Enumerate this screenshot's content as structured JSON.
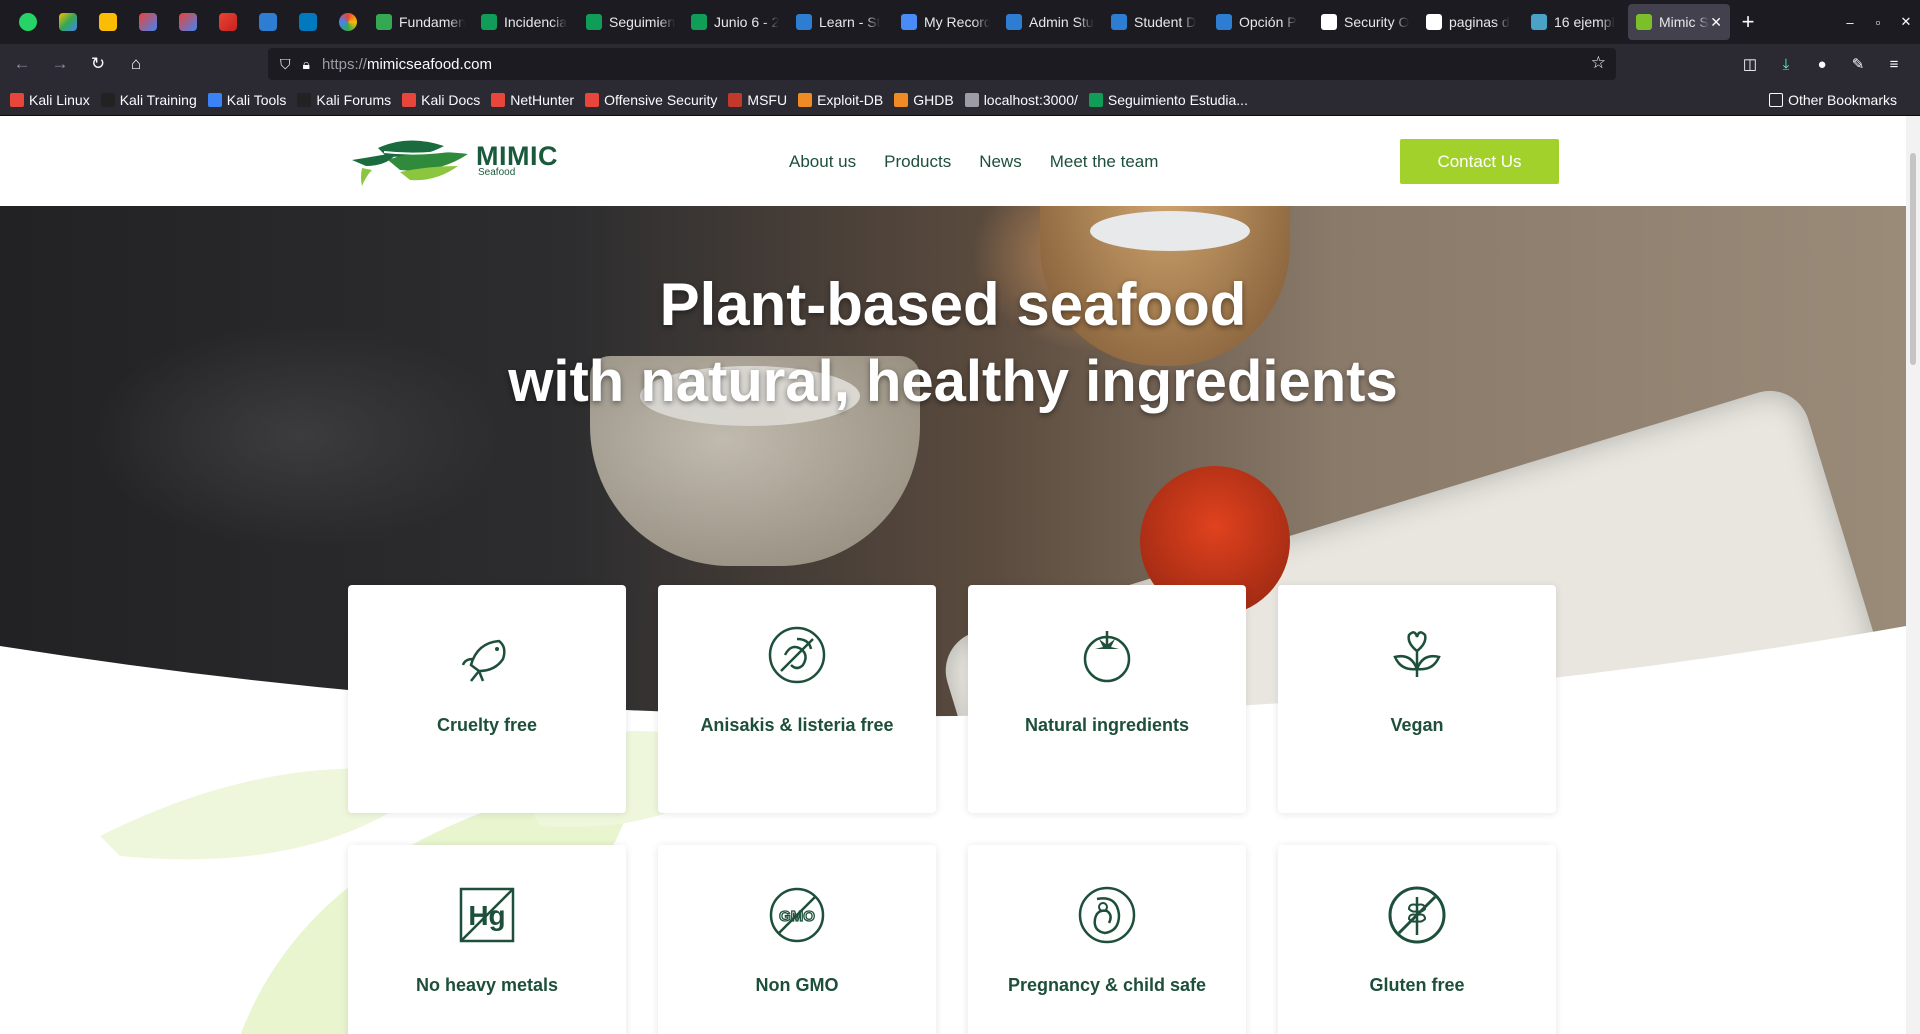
{
  "browser": {
    "tabs": [
      {
        "label": "Fundamen",
        "color": "#34a853"
      },
      {
        "label": "Incidencia",
        "color": "#0f9d58"
      },
      {
        "label": "Seguimien",
        "color": "#0f9d58"
      },
      {
        "label": "Junio 6 - 2",
        "color": "#0f9d58"
      },
      {
        "label": "Learn - St",
        "color": "#2d7dd2"
      },
      {
        "label": "My Record",
        "color": "#4a8cf7"
      },
      {
        "label": "Admin Stu",
        "color": "#2d7dd2"
      },
      {
        "label": "Student D",
        "color": "#2d7dd2"
      },
      {
        "label": "Opción P",
        "color": "#2d7dd2"
      },
      {
        "label": "Security O",
        "color": "#ffffff"
      },
      {
        "label": "paginas d",
        "color": "#ffffff"
      },
      {
        "label": "16 ejempl",
        "color": "#4aa3c7"
      }
    ],
    "active_tab": {
      "label": "Mimic S"
    },
    "url_proto": "https://",
    "url_host": "mimicseafood.com",
    "bookmarks": [
      {
        "label": "Kali Linux",
        "color": "#e8453c"
      },
      {
        "label": "Kali Training",
        "color": "#222222"
      },
      {
        "label": "Kali Tools",
        "color": "#3b82f6"
      },
      {
        "label": "Kali Forums",
        "color": "#222222"
      },
      {
        "label": "Kali Docs",
        "color": "#e8453c"
      },
      {
        "label": "NetHunter",
        "color": "#e8453c"
      },
      {
        "label": "Offensive Security",
        "color": "#e8453c"
      },
      {
        "label": "MSFU",
        "color": "#c0392b"
      },
      {
        "label": "Exploit-DB",
        "color": "#f08a24"
      },
      {
        "label": "GHDB",
        "color": "#f08a24"
      },
      {
        "label": "localhost:3000/",
        "color": "#9c9ca6"
      },
      {
        "label": "Seguimiento Estudia...",
        "color": "#0f9d58"
      }
    ],
    "other_bookmarks": "Other Bookmarks"
  },
  "site": {
    "logo": {
      "name": "MIMIC",
      "sub": "Seafood"
    },
    "nav": [
      "About us",
      "Products",
      "News",
      "Meet the team"
    ],
    "cta": "Contact Us",
    "hero_line1": "Plant-based seafood",
    "hero_line2": "with natural, healthy ingredients",
    "features": [
      {
        "label": "Cruelty free",
        "icon": "fish-icon"
      },
      {
        "label": "Anisakis & listeria free",
        "icon": "no-parasite-icon"
      },
      {
        "label": "Natural ingredients",
        "icon": "tomato-icon"
      },
      {
        "label": "Vegan",
        "icon": "vegan-heart-leaf-icon"
      },
      {
        "label": "No heavy metals",
        "icon": "no-mercury-icon"
      },
      {
        "label": "Non GMO",
        "icon": "non-gmo-icon"
      },
      {
        "label": "Pregnancy & child safe",
        "icon": "pregnancy-icon"
      },
      {
        "label": "Gluten free",
        "icon": "gluten-free-icon"
      }
    ],
    "brand_green": "#1d4f3a",
    "accent_lime": "#a3d12c"
  }
}
